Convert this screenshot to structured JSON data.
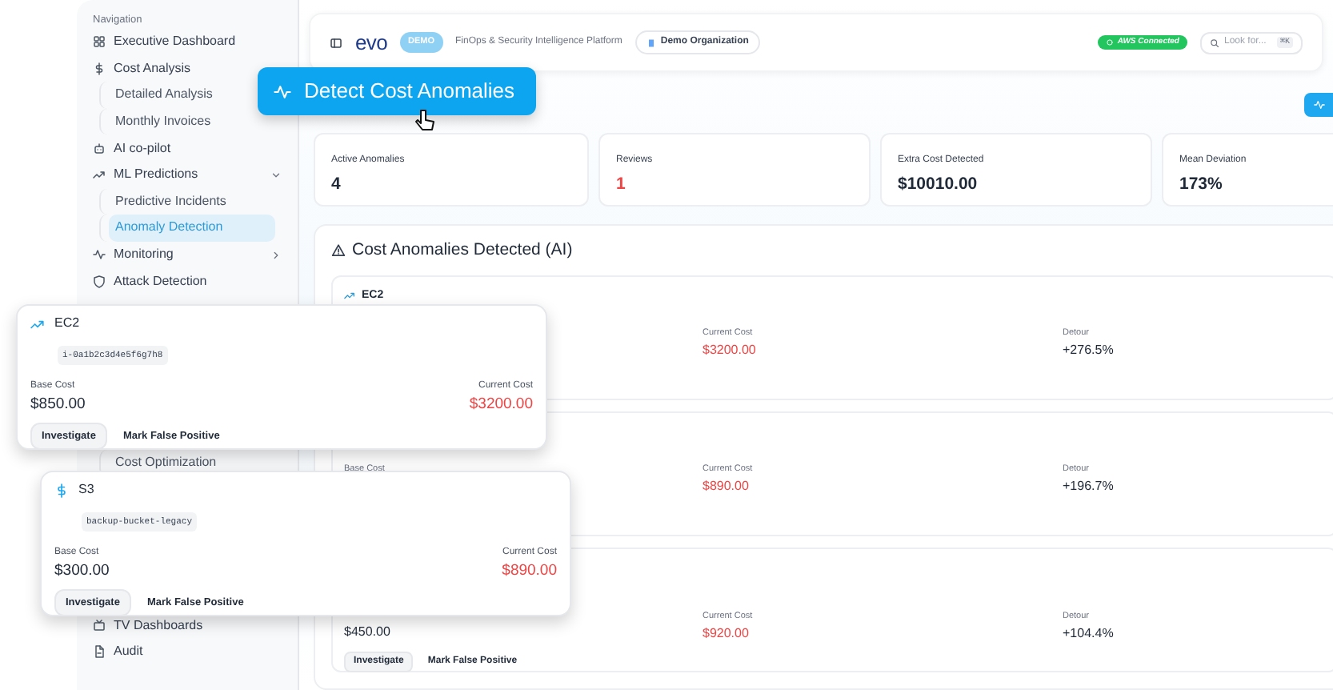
{
  "sidebar": {
    "heading": "Navigation",
    "items": [
      {
        "label": "Executive Dashboard",
        "kind": "dashboard",
        "selected": false
      },
      {
        "label": "Cost Analysis",
        "kind": "cost",
        "selected": false
      },
      {
        "label": "Detailed Analysis",
        "kind": "subitem",
        "selected": false
      },
      {
        "label": "Monthly Invoices",
        "kind": "subitem",
        "selected": false
      },
      {
        "label": "AI co-pilot",
        "kind": "copilot",
        "selected": false
      },
      {
        "label": "ML Predictions",
        "kind": "predictions",
        "expanded": true,
        "selected": false
      },
      {
        "label": "Predictive Incidents",
        "kind": "subitem",
        "selected": false
      },
      {
        "label": "Anomaly Detection",
        "kind": "subitem",
        "selected": true
      },
      {
        "label": "Monitoring",
        "kind": "monitoring",
        "expanded": false,
        "selected": false
      },
      {
        "label": "Attack Detection",
        "kind": "security",
        "selected": false
      },
      {
        "label": "Cost Optimization",
        "kind": "subitem",
        "selected": false
      },
      {
        "label": "TV Dashboards",
        "kind": "tv",
        "selected": false
      },
      {
        "label": "Audit",
        "kind": "audit",
        "selected": false
      }
    ]
  },
  "header": {
    "logo": "evo",
    "badge": "DEMO",
    "tagline": "FinOps & Security Intelligence Platform",
    "organization": "Demo Organization",
    "status": "AWS Connected",
    "search": {
      "placeholder": "Look for...",
      "shortcut": "⌘K"
    }
  },
  "callout": {
    "label": "Detect Cost Anomalies"
  },
  "stats": [
    {
      "label": "Active Anomalies",
      "value": "4",
      "alert": false
    },
    {
      "label": "Reviews",
      "value": "1",
      "alert": true
    },
    {
      "label": "Extra Cost Detected",
      "value": "$10010.00",
      "alert": false
    },
    {
      "label": "Mean Deviation",
      "value": "173%",
      "alert": false
    }
  ],
  "anomalies": {
    "title": "Cost Anomalies Detected (AI)",
    "rows": [
      {
        "service": "EC2",
        "current_cost_label": "Current Cost",
        "current_cost": "$3200.00",
        "detour_label": "Detour",
        "detour": "+276.5%"
      },
      {
        "base_cost_label": "Base Cost",
        "current_cost_label": "Current Cost",
        "current_cost": "$890.00",
        "detour_label": "Detour",
        "detour": "+196.7%"
      },
      {
        "base_cost": "$450.00",
        "current_cost_label": "Current Cost",
        "current_cost": "$920.00",
        "detour_label": "Detour",
        "detour": "+104.4%",
        "actions": [
          "Investigate",
          "Mark False Positive"
        ]
      }
    ]
  },
  "cards": [
    {
      "kind": "compute",
      "service": "EC2",
      "resource": "i-0a1b2c3d4e5f6g7h8",
      "base_cost_label": "Base Cost",
      "base_cost": "$850.00",
      "current_cost_label": "Current Cost",
      "current_cost": "$3200.00",
      "actions": [
        "Investigate",
        "Mark False Positive"
      ]
    },
    {
      "kind": "storage",
      "service": "S3",
      "resource": "backup-bucket-legacy",
      "base_cost_label": "Base Cost",
      "base_cost": "$300.00",
      "current_cost_label": "Current Cost",
      "current_cost": "$890.00",
      "actions": [
        "Investigate",
        "Mark False Positive"
      ]
    }
  ]
}
